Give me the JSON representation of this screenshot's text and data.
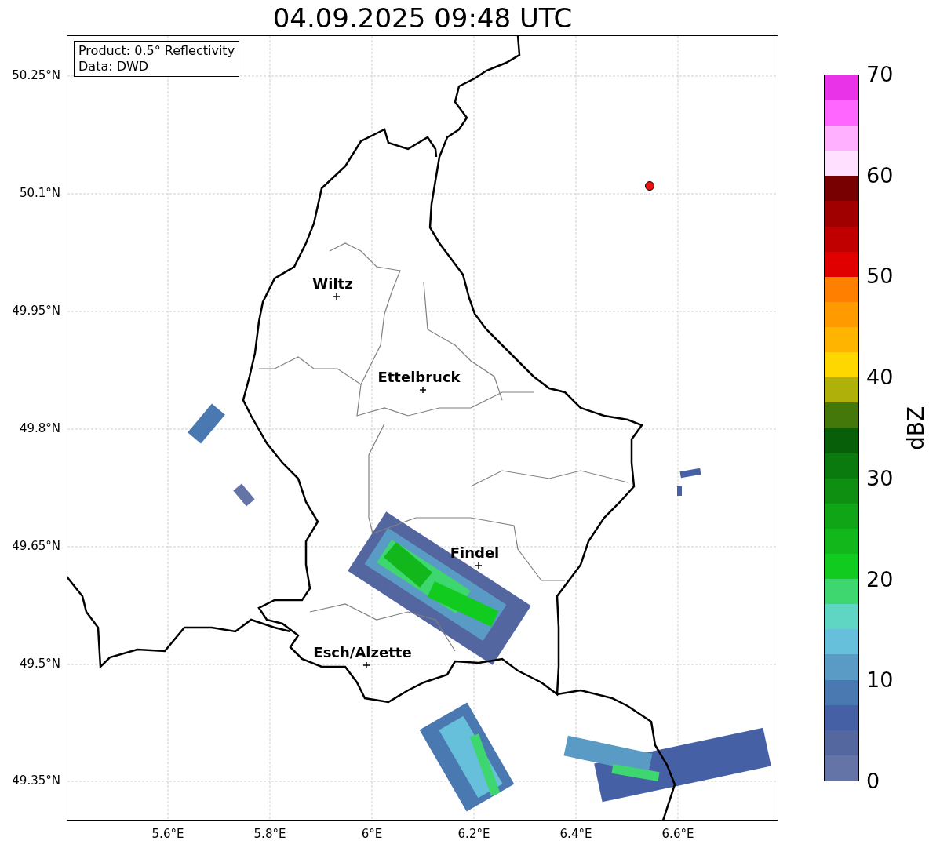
{
  "title": "04.09.2025 09:48 UTC",
  "info_box": {
    "lines": [
      "Product: 0.5° Reflectivity",
      "Data: DWD"
    ]
  },
  "map": {
    "lat_ticks": [
      "50.25°N",
      "50.1°N",
      "49.95°N",
      "49.8°N",
      "49.65°N",
      "49.5°N",
      "49.35°N"
    ],
    "lon_ticks": [
      "5.6°E",
      "5.8°E",
      "6°E",
      "6.2°E",
      "6.4°E",
      "6.6°E"
    ],
    "cities": [
      {
        "name": "Wiltz"
      },
      {
        "name": "Ettelbruck"
      },
      {
        "name": "Findel"
      },
      {
        "name": "Esch/Alzette"
      }
    ]
  },
  "colorbar": {
    "label": "dBZ",
    "ticks": [
      "70",
      "60",
      "50",
      "40",
      "30",
      "20",
      "10",
      "0"
    ],
    "bands": [
      {
        "color": "#6474a6"
      },
      {
        "color": "#55679f"
      },
      {
        "color": "#4560a5"
      },
      {
        "color": "#4a78b0"
      },
      {
        "color": "#5a9bc5"
      },
      {
        "color": "#66c0dc"
      },
      {
        "color": "#5fd6c3"
      },
      {
        "color": "#3ed66e"
      },
      {
        "color": "#11cc1f"
      },
      {
        "color": "#12b81b"
      },
      {
        "color": "#10a516"
      },
      {
        "color": "#0f8f12"
      },
      {
        "color": "#0b7a0e"
      },
      {
        "color": "#075f0a"
      },
      {
        "color": "#45780a"
      },
      {
        "color": "#b0b00a"
      },
      {
        "color": "#ffd700"
      },
      {
        "color": "#ffb400"
      },
      {
        "color": "#ff9a00"
      },
      {
        "color": "#ff7f00"
      },
      {
        "color": "#e00000"
      },
      {
        "color": "#c00000"
      },
      {
        "color": "#a00000"
      },
      {
        "color": "#780000"
      },
      {
        "color": "#ffe0ff"
      },
      {
        "color": "#ffb0ff"
      },
      {
        "color": "#ff66ff"
      },
      {
        "color": "#e833e8"
      }
    ]
  }
}
